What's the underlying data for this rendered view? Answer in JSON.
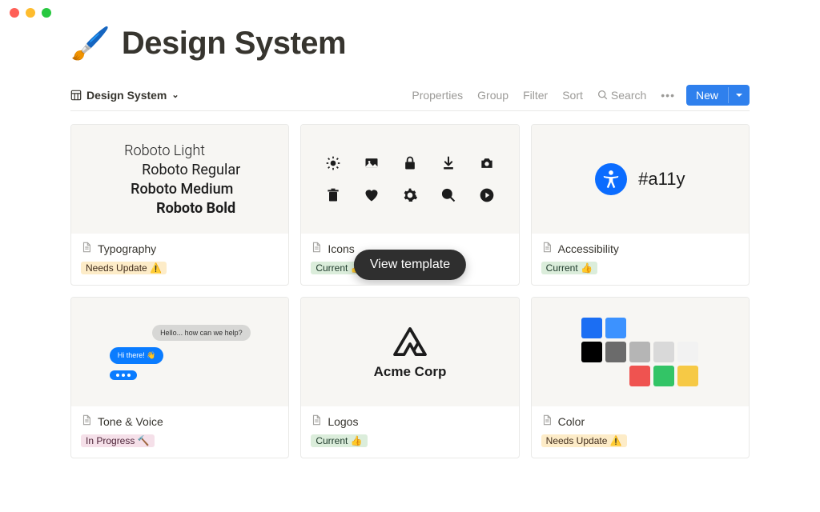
{
  "page": {
    "icon": "🖌️",
    "title": "Design System"
  },
  "view": {
    "name": "Design System"
  },
  "toolbar": {
    "properties": "Properties",
    "group": "Group",
    "filter": "Filter",
    "sort": "Sort",
    "search": "Search",
    "new": "New"
  },
  "tooltip": {
    "text": "View template"
  },
  "tags": {
    "needs_update": "Needs Update ⚠️",
    "current": "Current 👍",
    "in_progress": "In Progress 🔨"
  },
  "cards": {
    "typography": {
      "title": "Typography",
      "tag": "needs_update",
      "lines": [
        "Roboto Light",
        "Roboto Regular",
        "Roboto Medium",
        "Roboto Bold"
      ]
    },
    "icons": {
      "title": "Icons",
      "tag": "current"
    },
    "accessibility": {
      "title": "Accessibility",
      "tag": "current",
      "label": "#a11y"
    },
    "tone": {
      "title": "Tone & Voice",
      "tag": "in_progress",
      "msg1": "Hello... how can we help?",
      "msg2": "Hi there! 👋"
    },
    "logos": {
      "title": "Logos",
      "tag": "current",
      "company": "Acme Corp"
    },
    "color": {
      "title": "Color",
      "tag": "needs_update",
      "swatches": [
        [
          "#1b6ef3",
          "#3c92ff"
        ],
        [
          "#000000",
          "#6b6b6b",
          "#b5b5b5",
          "#d9d9d9",
          "#f2f2f2"
        ],
        [
          "#ef5350",
          "#33c466",
          "#f6c945"
        ]
      ]
    }
  }
}
